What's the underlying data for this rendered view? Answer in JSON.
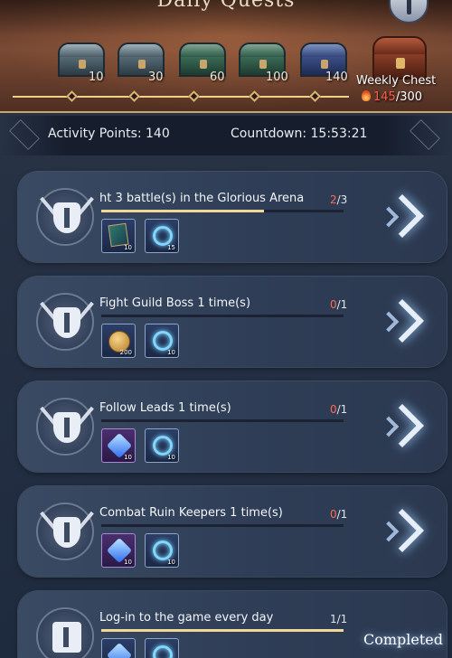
{
  "header": {
    "title": "Daily Quests",
    "chests": [
      {
        "points": "10"
      },
      {
        "points": "30"
      },
      {
        "points": "60"
      },
      {
        "points": "100"
      },
      {
        "points": "140"
      }
    ],
    "weekly": {
      "label": "Weekly Chest",
      "current": "145",
      "total": "/300"
    },
    "track_progress": 1.0
  },
  "activity": {
    "points_label": "Activity Points: 140",
    "countdown_label": "Countdown: 15:53:21"
  },
  "quests": [
    {
      "title": "ht 3 battle(s) in the Glorious Arena",
      "current": "2",
      "total": "/3",
      "progress": 0.67,
      "rewards": [
        {
          "icon": "book-icon",
          "amount": "10"
        },
        {
          "icon": "wisp-icon",
          "amount": "15"
        }
      ]
    },
    {
      "title": "Fight Guild Boss 1 time(s)",
      "current": "0",
      "total": "/1",
      "progress": 0,
      "rewards": [
        {
          "icon": "coin-icon",
          "amount": "200"
        },
        {
          "icon": "wisp-icon",
          "amount": "10"
        }
      ]
    },
    {
      "title": "Follow Leads 1 time(s)",
      "current": "0",
      "total": "/1",
      "progress": 0,
      "rewards": [
        {
          "icon": "gem-icon",
          "amount": "10"
        },
        {
          "icon": "wisp-icon",
          "amount": "10"
        }
      ]
    },
    {
      "title": "Combat Ruin Keepers 1 time(s)",
      "current": "0",
      "total": "/1",
      "progress": 0,
      "rewards": [
        {
          "icon": "gem-icon",
          "amount": "10"
        },
        {
          "icon": "wisp-icon",
          "amount": "10"
        }
      ]
    },
    {
      "title": "Log-in to the game every day",
      "current": "1",
      "total": "/1",
      "progress": 1.0,
      "status": "Completed",
      "rewards": [
        {
          "icon": "gem-icon",
          "amount": ""
        },
        {
          "icon": "wisp-icon",
          "amount": ""
        }
      ]
    }
  ]
}
